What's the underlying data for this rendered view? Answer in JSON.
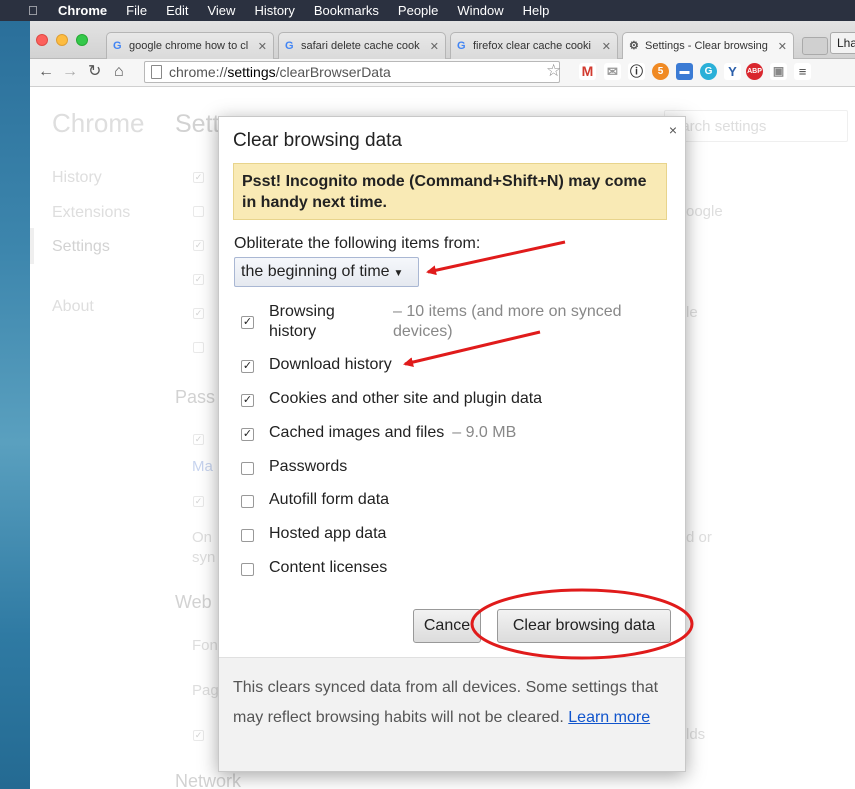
{
  "menubar": {
    "app": "Chrome",
    "items": [
      "File",
      "Edit",
      "View",
      "History",
      "Bookmarks",
      "People",
      "Window",
      "Help"
    ]
  },
  "tabs": [
    {
      "title": "google chrome how to cl",
      "icon": "google-icon"
    },
    {
      "title": "safari delete cache cook",
      "icon": "google-icon"
    },
    {
      "title": "firefox clear cache cooki",
      "icon": "google-icon"
    },
    {
      "title": "Settings - Clear browsing",
      "icon": "gear-icon",
      "active": true
    }
  ],
  "profile_label": "Lha",
  "omnibox": {
    "prefix": "chrome://",
    "host": "settings",
    "path": "/clearBrowserData"
  },
  "settings_page": {
    "title": "Chrome",
    "nav": [
      "History",
      "Extensions",
      "Settings",
      "About"
    ],
    "heading": "Sett",
    "search_placeholder": "earch settings",
    "sections": [
      "Pass",
      "Web",
      "Network"
    ],
    "fragments": {
      "google": "oogle",
      "le": "le",
      "manage": "Ma",
      "on": "On",
      "syn": "syn",
      "dor": "d or",
      "fon": "Fon",
      "pag": "Pag",
      "lds": "lds"
    }
  },
  "dialog": {
    "title": "Clear browsing data",
    "close": "×",
    "banner": "Psst! Incognito mode (Command+Shift+N) may come in handy next time.",
    "obliterate_label": "Obliterate the following items from:",
    "time_range": "the beginning of time",
    "items": [
      {
        "label": "Browsing history",
        "extra": "– 10 items (and more on synced devices)",
        "checked": true
      },
      {
        "label": "Download history",
        "extra": "",
        "checked": true
      },
      {
        "label": "Cookies and other site and plugin data",
        "extra": "",
        "checked": true
      },
      {
        "label": "Cached images and files",
        "extra": "– 9.0 MB",
        "checked": true
      },
      {
        "label": "Passwords",
        "extra": "",
        "checked": false
      },
      {
        "label": "Autofill form data",
        "extra": "",
        "checked": false
      },
      {
        "label": "Hosted app data",
        "extra": "",
        "checked": false
      },
      {
        "label": "Content licenses",
        "extra": "",
        "checked": false
      }
    ],
    "cancel": "Cance",
    "clear": "Clear browsing data",
    "footer_text": "This clears synced data from all devices. Some settings that may reflect browsing habits will not be cleared.",
    "footer_link": "Learn more"
  },
  "colors": {
    "annotation": "#e01b1b",
    "banner": "#f9eab5",
    "link": "#1155cc"
  }
}
